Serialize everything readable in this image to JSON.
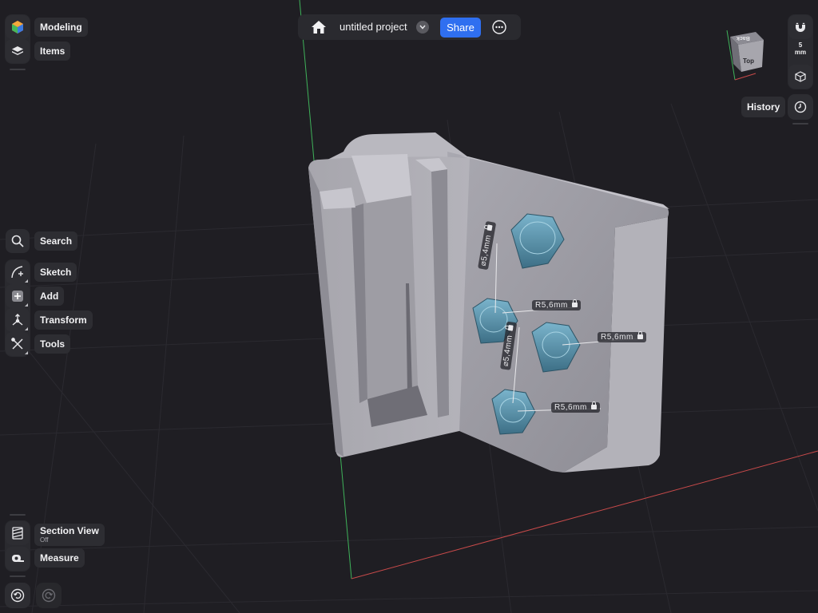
{
  "left_toolbar": {
    "modeling_label": "Modeling",
    "items_label": "Items",
    "search_label": "Search",
    "sketch_label": "Sketch",
    "add_label": "Add",
    "transform_label": "Transform",
    "tools_label": "Tools",
    "section_view_label": "Section View",
    "section_view_state": "Off",
    "measure_label": "Measure"
  },
  "top_bar": {
    "project_name": "untitled project",
    "share_label": "Share"
  },
  "right_toolbar": {
    "snap_value": "5",
    "snap_unit": "mm",
    "history_label": "History",
    "view_cube_top": "Top",
    "view_cube_back": "Back"
  },
  "dimensions": {
    "diameter_upper": "⌀5,4mm",
    "diameter_lower": "⌀5,4mm",
    "radius_a": "R5,6mm",
    "radius_b": "R5,6mm",
    "radius_c": "R5,6mm"
  },
  "colors": {
    "accent": "#2f6ff0",
    "background": "#1f1e23",
    "panel": "#2d2d32",
    "model": "#9a99a1",
    "pocket": "#4d8aa6",
    "axis_y": "#3fb25a",
    "axis_x": "#c84a4a"
  }
}
